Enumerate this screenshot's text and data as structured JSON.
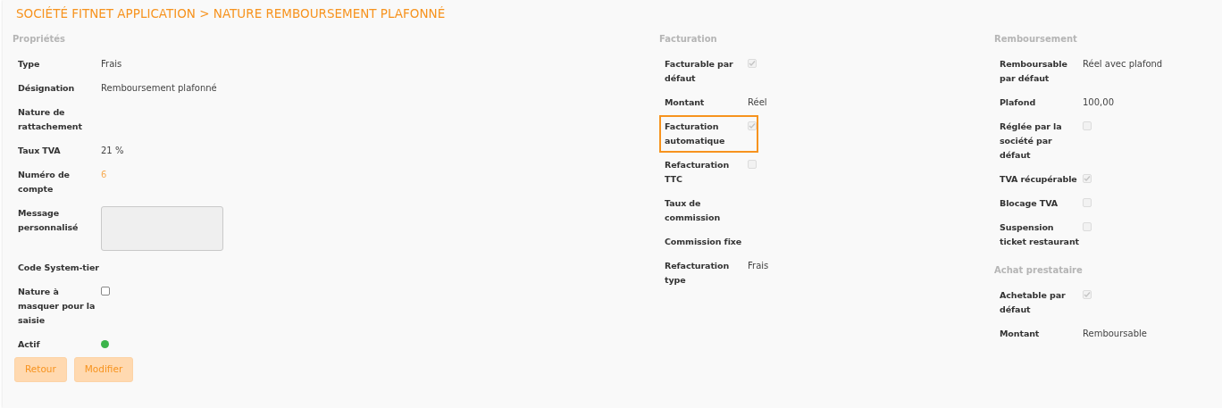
{
  "breadcrumb": "SOCIÉTÉ FITNET APPLICATION > NATURE REMBOURSEMENT PLAFONNÉ",
  "columns": [
    {
      "groups": [
        {
          "heading": "Propriétés",
          "rows": [
            {
              "label": "Type",
              "kind": "text",
              "value": "Frais"
            },
            {
              "label": "Désignation",
              "kind": "text",
              "value": "Remboursement plafonné"
            },
            {
              "label": "Nature de rattachement",
              "kind": "empty"
            },
            {
              "label": "Taux TVA",
              "kind": "text",
              "value": "21 %"
            },
            {
              "label": "Numéro de compte",
              "kind": "link",
              "value": "6"
            },
            {
              "label": "Message personnalisé",
              "kind": "textarea"
            },
            {
              "label": "Code System-tier",
              "kind": "empty"
            },
            {
              "label": "Nature à masquer pour la saisie",
              "kind": "checkbox",
              "checked": false,
              "disabled": false
            },
            {
              "label": "Actif",
              "kind": "status",
              "active": true
            }
          ]
        }
      ]
    },
    {
      "groups": [
        {
          "heading": "Facturation",
          "rows": [
            {
              "label": "Facturable par défaut",
              "kind": "checkbox",
              "checked": true,
              "disabled": true
            },
            {
              "label": "Montant",
              "kind": "text",
              "value": "Réel"
            },
            {
              "label": "Facturation automatique",
              "kind": "checkbox",
              "checked": true,
              "disabled": true,
              "highlighted": true
            },
            {
              "label": "Refacturation TTC",
              "kind": "checkbox",
              "checked": false,
              "disabled": true
            },
            {
              "label": "Taux de commission",
              "kind": "empty"
            },
            {
              "label": "Commission fixe",
              "kind": "empty"
            },
            {
              "label": "Refacturation type",
              "kind": "text",
              "value": "Frais"
            }
          ]
        }
      ]
    },
    {
      "groups": [
        {
          "heading": "Remboursement",
          "rows": [
            {
              "label": "Remboursable par défaut",
              "kind": "text",
              "value": "Réel avec plafond"
            },
            {
              "label": "Plafond",
              "kind": "text",
              "value": "100,00"
            },
            {
              "label": "Réglée par la société par défaut",
              "kind": "checkbox",
              "checked": false,
              "disabled": true
            },
            {
              "label": "TVA récupérable",
              "kind": "checkbox",
              "checked": true,
              "disabled": true
            },
            {
              "label": "Blocage TVA",
              "kind": "checkbox",
              "checked": false,
              "disabled": true
            },
            {
              "label": "Suspension ticket restaurant",
              "kind": "checkbox",
              "checked": false,
              "disabled": true
            }
          ]
        },
        {
          "heading": "Achat prestataire",
          "rows": [
            {
              "label": "Achetable par défaut",
              "kind": "checkbox",
              "checked": true,
              "disabled": true
            },
            {
              "label": "Montant",
              "kind": "text",
              "value": "Remboursable"
            }
          ]
        }
      ]
    }
  ],
  "buttons": [
    "Retour",
    "Modifier"
  ]
}
